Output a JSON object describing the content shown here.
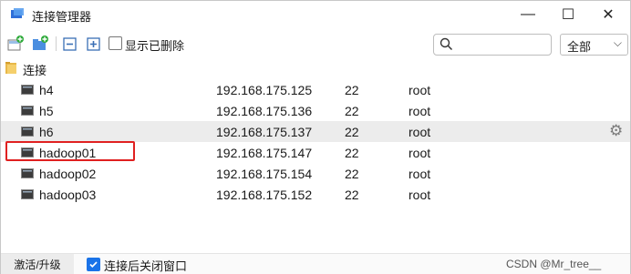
{
  "window": {
    "title": "连接管理器"
  },
  "titlebar": {
    "minimize_glyph": "—",
    "maximize_glyph": "☐",
    "close_glyph": "✕"
  },
  "toolbar": {
    "icons": [
      "new-connection-icon",
      "new-folder-icon",
      "collapse-all-icon",
      "expand-all-icon"
    ],
    "show_deleted_label": "显示已删除",
    "show_deleted_checked": false,
    "search": {
      "value": "",
      "placeholder": ""
    },
    "filter": {
      "selected": "全部"
    }
  },
  "tree": {
    "group_name": "连接",
    "hosts": [
      {
        "name": "h4",
        "ip": "192.168.175.125",
        "port": "22",
        "user": "root"
      },
      {
        "name": "h5",
        "ip": "192.168.175.136",
        "port": "22",
        "user": "root"
      },
      {
        "name": "h6",
        "ip": "192.168.175.137",
        "port": "22",
        "user": "root"
      },
      {
        "name": "hadoop01",
        "ip": "192.168.175.147",
        "port": "22",
        "user": "root"
      },
      {
        "name": "hadoop02",
        "ip": "192.168.175.154",
        "port": "22",
        "user": "root"
      },
      {
        "name": "hadoop03",
        "ip": "192.168.175.152",
        "port": "22",
        "user": "root"
      }
    ],
    "hovered_row": 2,
    "highlighted_row": 3
  },
  "status": {
    "upgrade_label": "激活/升级",
    "close_after_connect_label": "连接后关闭窗口",
    "close_after_connect_checked": true,
    "watermark": "CSDN @Mr_tree__"
  },
  "colors": {
    "highlight_box": "#e02020",
    "folder": "#e8b84a",
    "checkbox_accent": "#1a73e8"
  }
}
